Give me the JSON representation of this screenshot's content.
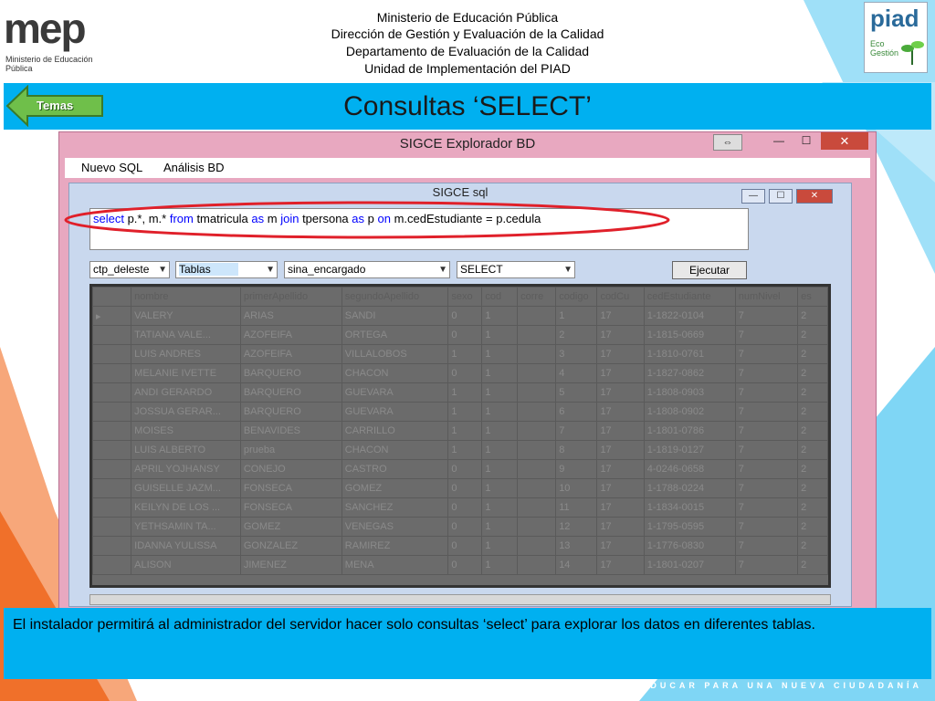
{
  "header": {
    "line1": "Ministerio de Educación Pública",
    "line2": "Dirección de Gestión y Evaluación de la Calidad",
    "line3": "Departamento de Evaluación de la Calidad",
    "line4": "Unidad de Implementación del PIAD",
    "mep_logo": "mep",
    "mep_sub": "Ministerio de Educación Pública",
    "piad_logo": "piad",
    "piad_sub": "Eco Gestión"
  },
  "slide": {
    "title": "Consultas ‘SELECT’",
    "back_button": "Temas",
    "caption": "El instalador permitirá al administrador del servidor hacer solo consultas  ‘select’ para  explorar los datos en diferentes tablas.",
    "footer": "EDUCAR PARA UNA NUEVA CIUDADANÍA"
  },
  "window": {
    "title": "SIGCE Explorador BD",
    "close_glyph": "✕",
    "max_glyph": "☐",
    "min_glyph": "—",
    "restore_glyph": "⇔",
    "menu": [
      "Nuevo SQL",
      "Análisis BD"
    ]
  },
  "inner": {
    "title": "SIGCE sql",
    "sql": {
      "t1": "select",
      "t2": " p.*, m.* ",
      "t3": "from",
      "t4": " tmatricula ",
      "t5": "as",
      "t6": " m ",
      "t7": "join",
      "t8": " tpersona ",
      "t9": "as",
      "t10": " p ",
      "t11": "on",
      "t12": " m.cedEstudiante = p.cedula"
    },
    "selects": [
      "ctp_deleste",
      "Tablas",
      "sina_encargado",
      "SELECT"
    ],
    "execute_label": "Ejecutar",
    "columns": [
      "",
      "nombre",
      "primerApellido",
      "segundoApellido",
      "sexo",
      "cod",
      "corre",
      "codigo",
      "codCu",
      "cedEstudiante",
      "numNivel",
      "es"
    ],
    "rows": [
      [
        "▸",
        "VALERY",
        "ARIAS",
        "SANDI",
        "0",
        "1",
        "",
        "1",
        "17",
        "1-1822-0104",
        "7",
        "2"
      ],
      [
        "",
        "TATIANA VALE...",
        "AZOFEIFA",
        "ORTEGA",
        "0",
        "1",
        "",
        "2",
        "17",
        "1-1815-0669",
        "7",
        "2"
      ],
      [
        "",
        "LUIS ANDRES",
        "AZOFEIFA",
        "VILLALOBOS",
        "1",
        "1",
        "",
        "3",
        "17",
        "1-1810-0761",
        "7",
        "2"
      ],
      [
        "",
        "MELANIE IVETTE",
        "BARQUERO",
        "CHACON",
        "0",
        "1",
        "",
        "4",
        "17",
        "1-1827-0862",
        "7",
        "2"
      ],
      [
        "",
        "ANDI GERARDO",
        "BARQUERO",
        "GUEVARA",
        "1",
        "1",
        "",
        "5",
        "17",
        "1-1808-0903",
        "7",
        "2"
      ],
      [
        "",
        "JOSSUA GERAR...",
        "BARQUERO",
        "GUEVARA",
        "1",
        "1",
        "",
        "6",
        "17",
        "1-1808-0902",
        "7",
        "2"
      ],
      [
        "",
        "MOISES",
        "BENAVIDES",
        "CARRILLO",
        "1",
        "1",
        "",
        "7",
        "17",
        "1-1801-0786",
        "7",
        "2"
      ],
      [
        "",
        "LUIS ALBERTO",
        "prueba",
        "CHACON",
        "1",
        "1",
        "",
        "8",
        "17",
        "1-1819-0127",
        "7",
        "2"
      ],
      [
        "",
        "APRIL YOJHANSY",
        "CONEJO",
        "CASTRO",
        "0",
        "1",
        "",
        "9",
        "17",
        "4-0246-0658",
        "7",
        "2"
      ],
      [
        "",
        "GUISELLE JAZM...",
        "FONSECA",
        "GOMEZ",
        "0",
        "1",
        "",
        "10",
        "17",
        "1-1788-0224",
        "7",
        "2"
      ],
      [
        "",
        "KEILYN DE LOS ...",
        "FONSECA",
        "SANCHEZ",
        "0",
        "1",
        "",
        "11",
        "17",
        "1-1834-0015",
        "7",
        "2"
      ],
      [
        "",
        "YETHSAMIN TA...",
        "GOMEZ",
        "VENEGAS",
        "0",
        "1",
        "",
        "12",
        "17",
        "1-1795-0595",
        "7",
        "2"
      ],
      [
        "",
        "IDANNA YULISSA",
        "GONZALEZ",
        "RAMIREZ",
        "0",
        "1",
        "",
        "13",
        "17",
        "1-1776-0830",
        "7",
        "2"
      ],
      [
        "",
        "ALISON",
        "JIMENEZ",
        "MENA",
        "0",
        "1",
        "",
        "14",
        "17",
        "1-1801-0207",
        "7",
        "2"
      ]
    ]
  },
  "colors": {
    "accent_blue": "#00b0f0",
    "window_pink": "#e8a8c0",
    "annotation_red": "#e0202a",
    "back_arrow_green": "#6fbf4a"
  }
}
